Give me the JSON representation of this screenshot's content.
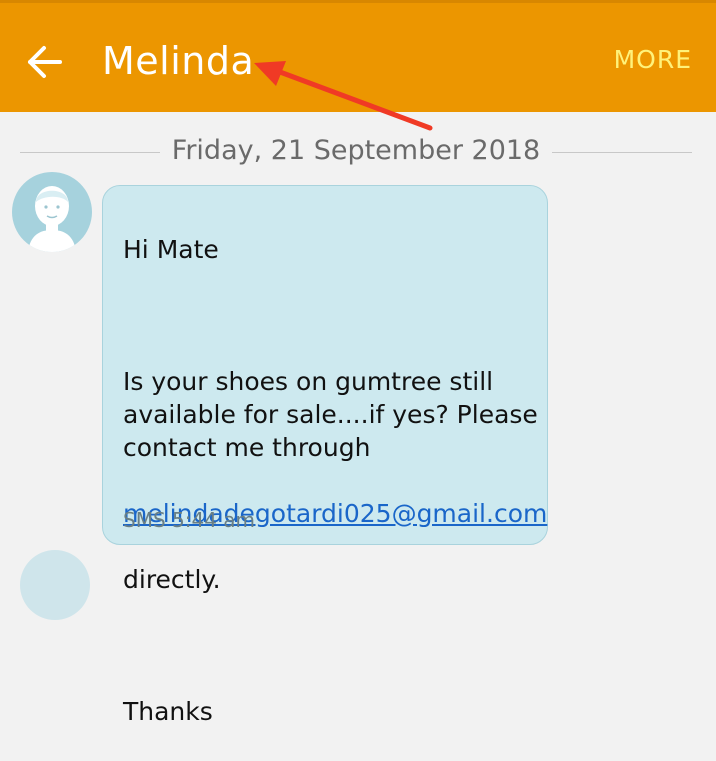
{
  "header": {
    "title": "Melinda",
    "more_label": "MORE",
    "back_icon": "arrow-left-icon",
    "background_color": "#ec9600"
  },
  "conversation": {
    "date_divider": "Friday, 21 September 2018",
    "message": {
      "line1": "Hi Mate",
      "line2": "Is your shoes on gumtree still available for sale....if yes? Please contact me through",
      "email": "melindadegotardi025@gmail.com",
      "line3": "directly.",
      "line4": "Thanks",
      "meta": "SMS 5:44 am"
    },
    "bubble_color": "#cde9ef",
    "link_color": "#1a66c9"
  },
  "annotation": {
    "arrow_color": "#f03a25"
  }
}
